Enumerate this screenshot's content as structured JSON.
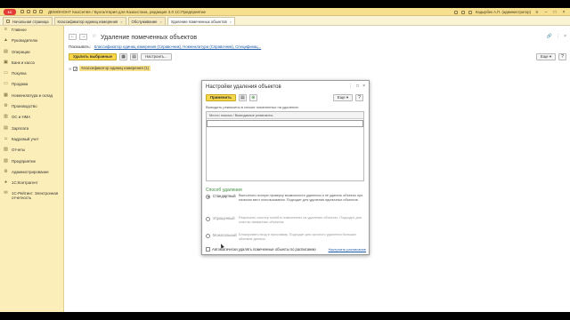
{
  "app": {
    "logo_text": "1С",
    "title": "ДЕМОНОНТ КазCentre / Бухгалтерия для Казахстана, редакция 3.0 1С:Предприятие",
    "user": "Кадырбек А.П. (администратор)"
  },
  "tabs": [
    {
      "label": "Начальная страница"
    },
    {
      "label": "Классификатор единиц измерения"
    },
    {
      "label": "Обслуживание"
    },
    {
      "label": "Удаление помеченных объектов"
    }
  ],
  "sidebar": {
    "items": [
      {
        "label": "Главное",
        "icon": "≡"
      },
      {
        "label": "Руководителю",
        "icon": "▲"
      },
      {
        "label": "Операции",
        "icon": "▤"
      },
      {
        "label": "Банк и касса",
        "icon": "▣"
      },
      {
        "label": "Покупка",
        "icon": "▭"
      },
      {
        "label": "Продажа",
        "icon": "▭"
      },
      {
        "label": "Номенклатура и склад",
        "icon": "▦"
      },
      {
        "label": "Производство",
        "icon": "⚙"
      },
      {
        "label": "ОС и НМА",
        "icon": "▥"
      },
      {
        "label": "Зарплата",
        "icon": "▤"
      },
      {
        "label": "Кадровый учет",
        "icon": "☺"
      },
      {
        "label": "Отчеты",
        "icon": "▧"
      },
      {
        "label": "Предприятие",
        "icon": "▨"
      },
      {
        "label": "Администрирование",
        "icon": "⚙"
      },
      {
        "label": "1С:Контрагент",
        "icon": "●"
      },
      {
        "label": "1С-Рейтинг: Электронная отчетность",
        "icon": "✉"
      }
    ]
  },
  "main": {
    "back": "←",
    "forward": "→",
    "star": "☆",
    "title": "Удаление помеченных объектов",
    "link_icon": "🔗",
    "more_icon": "⋮",
    "close_icon": "×",
    "show_label": "Показывать:",
    "show_link": "Классификатор единиц измерения (Справочник), Номенклатура (Справочник), Спецификац...",
    "delete_btn": "Удалить выбранные",
    "configure_btn": "Настроить...",
    "more_btn": "Еще ▾",
    "help_btn": "?",
    "tree_item": "Классификатор единиц измерения (1)"
  },
  "dialog": {
    "title": "Настройки удаления объектов",
    "apply_btn": "Применить",
    "more_btn": "Еще ▾",
    "help_btn": "?",
    "hint": "Выводить реквизиты в списке помеченных на удаление:",
    "table_header": "Место поиска / Выводимые реквизиты",
    "section_title": "Способ удаления",
    "options": [
      {
        "name": "Стандартный",
        "desc": "Выполнять полную проверку возможности удаления и не удалять объекты при наличии мест использования. Подходит для удаления единичных объектов.",
        "selected": true
      },
      {
        "name": "Упрощенный",
        "desc": "Разрешить очистку полей в помеченных на удаление объектах. Подходит для очистки связанных объектов.",
        "selected": false
      },
      {
        "name": "Монопольный",
        "desc": "Блокировать вход в программу. Подходит для срочного удаления больших объемов данных.",
        "selected": false
      }
    ],
    "auto_label": "Автоматически удалять помеченные объекты по расписанию",
    "schedule_link": "Настроить расписание"
  },
  "colors": {
    "titlebar": "#f6df8f",
    "sidebar": "#fbeeb8",
    "primary_button": "#f8d84a",
    "link": "#1c5aa6",
    "section_green": "#3c8a3c"
  }
}
